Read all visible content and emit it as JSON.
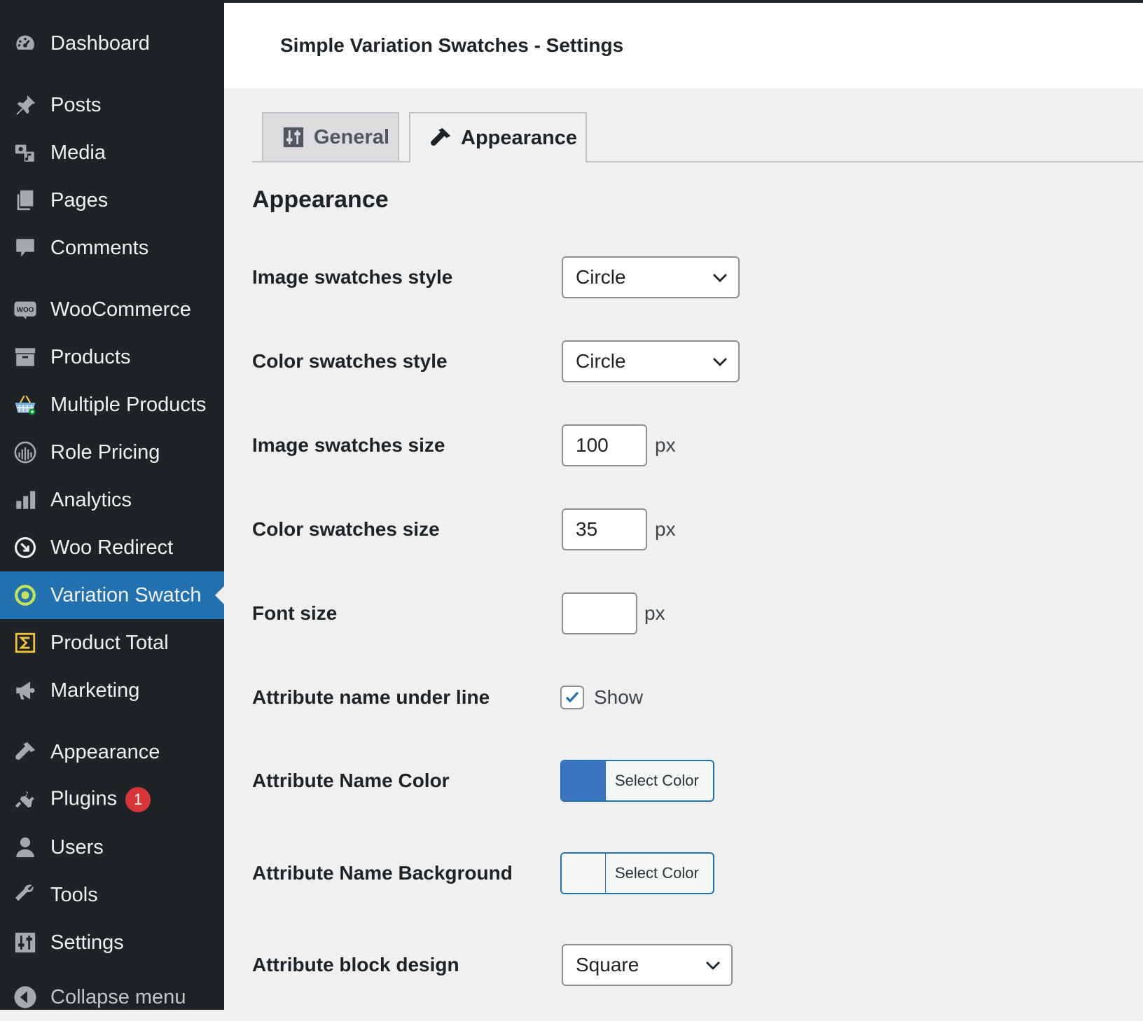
{
  "sidebar": {
    "items": [
      {
        "label": "Dashboard",
        "icon": "dashboard-icon"
      },
      {
        "label": "Posts",
        "icon": "pin-icon"
      },
      {
        "label": "Media",
        "icon": "media-icon"
      },
      {
        "label": "Pages",
        "icon": "pages-icon"
      },
      {
        "label": "Comments",
        "icon": "comment-icon"
      },
      {
        "label": "WooCommerce",
        "icon": "woo-icon"
      },
      {
        "label": "Products",
        "icon": "archive-icon"
      },
      {
        "label": "Multiple Products",
        "icon": "basket-icon"
      },
      {
        "label": "Role Pricing",
        "icon": "fingerprint-icon"
      },
      {
        "label": "Analytics",
        "icon": "bar-chart-icon"
      },
      {
        "label": "Woo Redirect",
        "icon": "redirect-icon"
      },
      {
        "label": "Variation Swatch",
        "icon": "ring-icon",
        "active": true
      },
      {
        "label": "Product Total",
        "icon": "sigma-icon"
      },
      {
        "label": "Marketing",
        "icon": "megaphone-icon"
      },
      {
        "label": "Appearance",
        "icon": "brush-icon"
      },
      {
        "label": "Plugins",
        "icon": "plug-icon",
        "badge": "1"
      },
      {
        "label": "Users",
        "icon": "user-icon"
      },
      {
        "label": "Tools",
        "icon": "wrench-icon"
      },
      {
        "label": "Settings",
        "icon": "sliders-icon"
      },
      {
        "label": "Collapse menu",
        "icon": "collapse-icon"
      }
    ],
    "active_color": "#2271b1",
    "background": "#1d2327"
  },
  "header": {
    "title": "Simple Variation Swatches - Settings"
  },
  "tabs": [
    {
      "label": "General",
      "icon": "sliders-icon",
      "active": false
    },
    {
      "label": "Appearance",
      "icon": "brush-icon",
      "active": true
    }
  ],
  "section": {
    "title": "Appearance"
  },
  "form": {
    "image_swatches_style": {
      "label": "Image swatches style",
      "value": "Circle"
    },
    "color_swatches_style": {
      "label": "Color swatches style",
      "value": "Circle"
    },
    "image_swatches_size": {
      "label": "Image swatches size",
      "value": "100",
      "unit": "px"
    },
    "color_swatches_size": {
      "label": "Color swatches size",
      "value": "35",
      "unit": "px"
    },
    "font_size": {
      "label": "Font size",
      "value": "",
      "unit": "px"
    },
    "attribute_name_underline": {
      "label": "Attribute name under line",
      "checkbox_label": "Show",
      "checked": true
    },
    "attribute_name_color": {
      "label": "Attribute Name Color",
      "button": "Select Color",
      "color": "#3a73c0"
    },
    "attribute_name_background": {
      "label": "Attribute Name Background",
      "button": "Select Color",
      "color": "#f6f7f7"
    },
    "attribute_block_design": {
      "label": "Attribute block design",
      "value": "Square"
    }
  }
}
